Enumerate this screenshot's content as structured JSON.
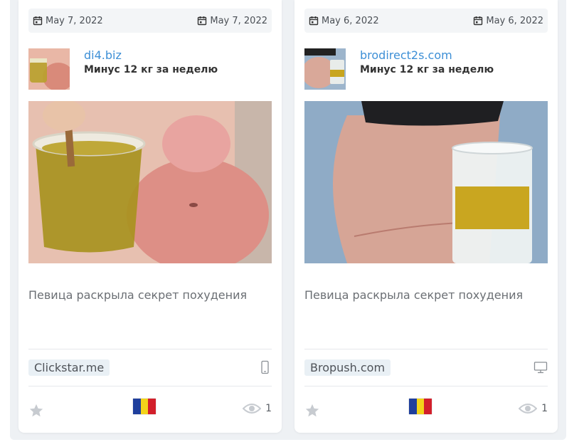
{
  "cards": [
    {
      "date_left": "May 7, 2022",
      "date_right": "May 7, 2022",
      "domain": "di4.biz",
      "headline": "Минус 12 кг за неделю",
      "description": "Певица раскрыла секрет похудения",
      "network": "Clickstar.me",
      "device": "mobile-icon",
      "views": "1",
      "flag_colors": [
        "#1f3f9c",
        "#f3d31a",
        "#d21f2b"
      ]
    },
    {
      "date_left": "May 6, 2022",
      "date_right": "May 6, 2022",
      "domain": "brodirect2s.com",
      "headline": "Минус 12 кг за неделю",
      "description": "Певица раскрыла секрет похудения",
      "network": "Bropush.com",
      "device": "desktop-icon",
      "views": "1",
      "flag_colors": [
        "#1f3f9c",
        "#f3d31a",
        "#d21f2b"
      ]
    }
  ],
  "colors": {
    "accent_link": "#3d8fd6",
    "background": "#eef1f4",
    "card": "#ffffff"
  }
}
